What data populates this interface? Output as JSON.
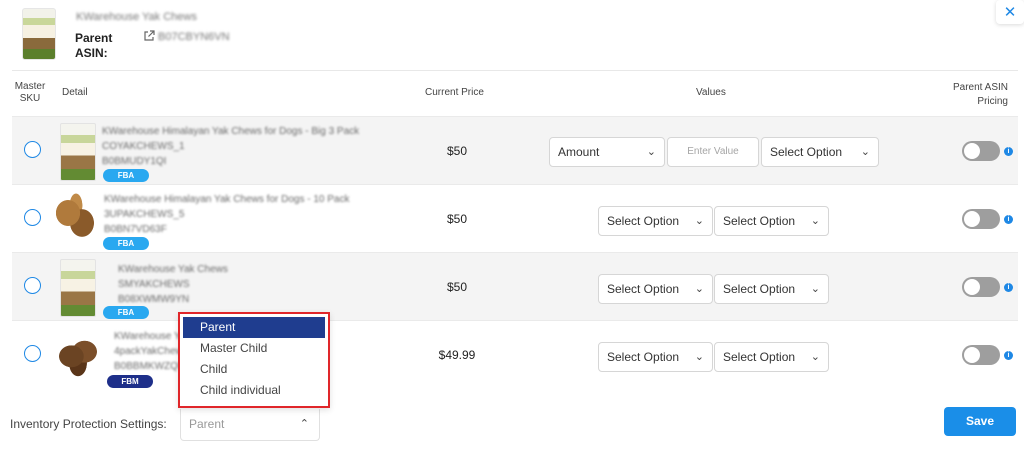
{
  "modal": {
    "close_icon": "close-icon"
  },
  "header": {
    "product_title": "KWarehouse Yak Chews",
    "parent_label": "Parent",
    "asin_label": "ASIN:",
    "asin_value": "B07CBYN6VN",
    "link_icon": "external-link-icon"
  },
  "table": {
    "columns": {
      "master_sku": "Master SKU",
      "detail": "Detail",
      "current_price": "Current Price",
      "values": "Values",
      "parent_asin_pricing": "Parent ASIN Pricing"
    },
    "rows": [
      {
        "title": "KWarehouse Himalayan Yak Chews for Dogs - Big 3 Pack",
        "sku": "COYAKCHEWS_1",
        "asin": "B0BMUDY1QI",
        "badge": "FBA",
        "price": "$50",
        "amount_select": "Amount",
        "value_placeholder": "Enter Value",
        "option_select": "Select Option"
      },
      {
        "title": "KWarehouse Himalayan Yak Chews for Dogs - 10 Pack",
        "sku": "3UPAKCHEWS_5",
        "asin": "B0BN7VD63F",
        "badge": "FBA",
        "price": "$50",
        "select_1": "Select Option",
        "select_2": "Select Option"
      },
      {
        "title": "KWarehouse Yak Chews",
        "sku": "SMYAKCHEWS",
        "asin": "B08XWMW9YN",
        "badge": "FBA",
        "price": "$50",
        "select_1": "Select Option",
        "select_2": "Select Option"
      },
      {
        "title": "KWarehouse Yak Chews",
        "sku": "4packYakChews",
        "asin": "B0BBMKWZQB",
        "badge": "FBM",
        "price": "$49.99",
        "select_1": "Select Option",
        "select_2": "Select Option"
      }
    ]
  },
  "footer": {
    "inventory_label": "Inventory Protection Settings:",
    "inventory_select": "Parent",
    "save_label": "Save"
  },
  "dropdown": {
    "options": [
      "Parent",
      "Master Child",
      "Child",
      "Child individual"
    ],
    "selected": "Parent"
  },
  "colors": {
    "accent": "#1a8ee8",
    "fba_badge": "#29a8f0",
    "fbm_badge": "#1e2f8a",
    "dropdown_selected": "#1f3d8f",
    "highlight_border": "#e0262a"
  }
}
